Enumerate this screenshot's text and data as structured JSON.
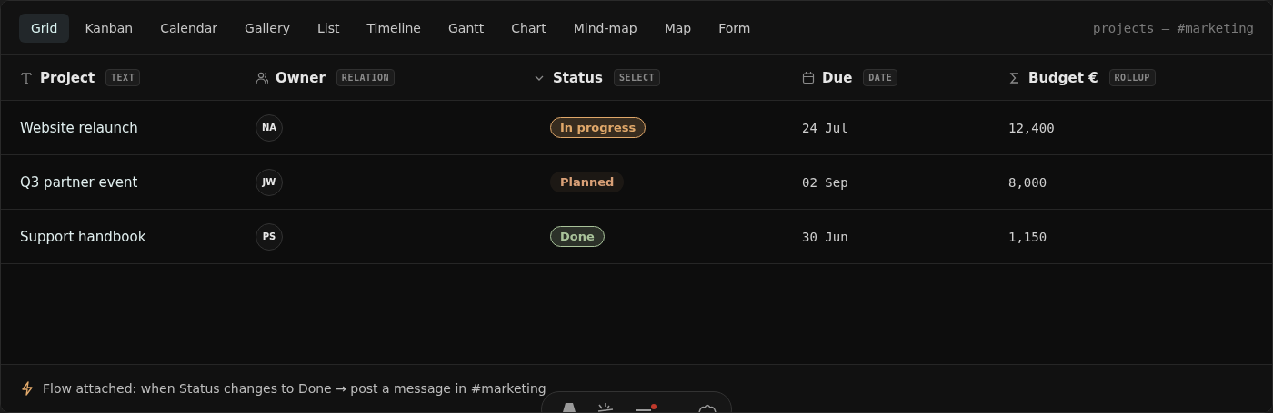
{
  "tabs": [
    {
      "label": "Grid",
      "selected": true
    },
    {
      "label": "Kanban",
      "selected": false
    },
    {
      "label": "Calendar",
      "selected": false
    },
    {
      "label": "Gallery",
      "selected": false
    },
    {
      "label": "List",
      "selected": false
    },
    {
      "label": "Timeline",
      "selected": false
    },
    {
      "label": "Gantt",
      "selected": false
    },
    {
      "label": "Chart",
      "selected": false
    },
    {
      "label": "Mind-map",
      "selected": false
    },
    {
      "label": "Map",
      "selected": false
    },
    {
      "label": "Form",
      "selected": false
    }
  ],
  "breadcrumb": "projects — #marketing",
  "table": {
    "columns": [
      {
        "name": "Project",
        "type": "TEXT",
        "kind": "text"
      },
      {
        "name": "Owner",
        "type": "RELATION",
        "kind": "relation"
      },
      {
        "name": "Status",
        "type": "SELECT",
        "kind": "select"
      },
      {
        "name": "Due",
        "type": "DATE",
        "kind": "date"
      },
      {
        "name": "Budget €",
        "type": "ROLLUP",
        "kind": "rollup"
      }
    ],
    "rows": [
      {
        "project": "Website relaunch",
        "owner": "NA",
        "status": {
          "label": "In progress",
          "color": "#e0a86a",
          "outlined": true
        },
        "due": "24 Jul",
        "budget": "12,400"
      },
      {
        "project": "Q3 partner event",
        "owner": "JW",
        "status": {
          "label": "Planned",
          "color": "#d9a077",
          "outlined": false
        },
        "due": "02 Sep",
        "budget": "8,000"
      },
      {
        "project": "Support handbook",
        "owner": "PS",
        "status": {
          "label": "Done",
          "color": "#a9c39a",
          "outlined": true
        },
        "due": "30 Jun",
        "budget": "1,150"
      }
    ]
  },
  "footer": {
    "text": "Flow attached: when Status changes to Done → post a message in #marketing"
  }
}
